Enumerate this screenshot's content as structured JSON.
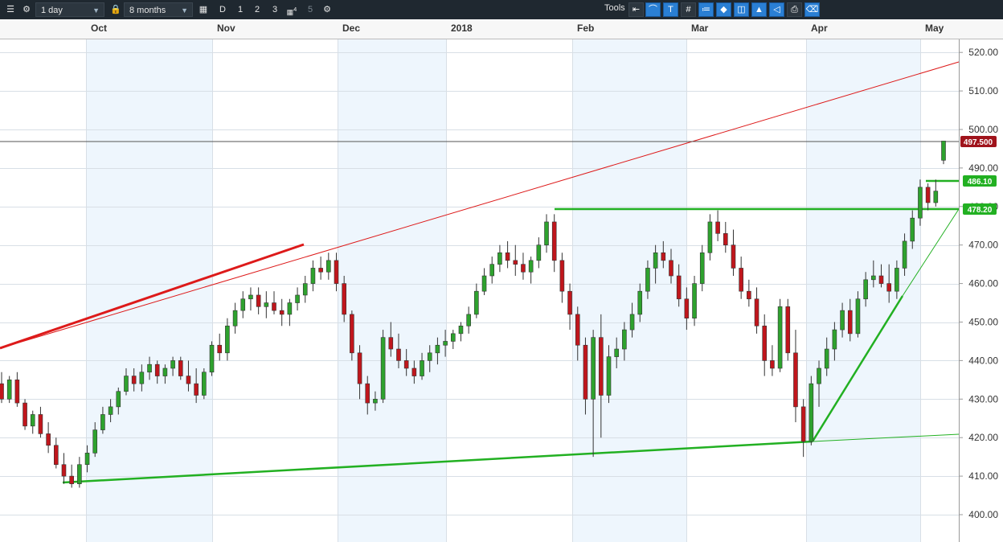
{
  "toolbar": {
    "interval": "1 day",
    "range": "8 months",
    "period_buttons": [
      "D",
      "1",
      "2",
      "3",
      "4",
      "5"
    ],
    "tools_label": "Tools"
  },
  "chart_data": {
    "type": "candlestick",
    "x_tick_labels": [
      "Oct",
      "Nov",
      "Dec",
      "2018",
      "Feb",
      "Mar",
      "Apr",
      "May"
    ],
    "y_tick_labels": [
      "400.00",
      "410.00",
      "420.00",
      "430.00",
      "440.00",
      "450.00",
      "460.00",
      "470.00",
      "480.00",
      "490.00",
      "500.00",
      "510.00",
      "520.00"
    ],
    "ylim": [
      394,
      530
    ],
    "current_price": "497.500",
    "price_tags": [
      {
        "value": "497.500",
        "color": "#a0141c"
      },
      {
        "value": "486.10",
        "color": "#22b022"
      },
      {
        "value": "478.20",
        "color": "#22b022"
      }
    ],
    "colors": {
      "up": "#2ea22e",
      "down": "#c0161c",
      "trend_green": "#22b022",
      "trend_red": "#dd1a1a",
      "shade": "#eef6fd"
    },
    "candles": [
      [
        434,
        437,
        429,
        430
      ],
      [
        430,
        436,
        429,
        435
      ],
      [
        435,
        437,
        428,
        429
      ],
      [
        429,
        430,
        422,
        423
      ],
      [
        423,
        427,
        421,
        426
      ],
      [
        426,
        428,
        420,
        421
      ],
      [
        421,
        424,
        416,
        418
      ],
      [
        418,
        420,
        412,
        413
      ],
      [
        413,
        416,
        408,
        410
      ],
      [
        410,
        413,
        407,
        408
      ],
      [
        408,
        415,
        407,
        413
      ],
      [
        413,
        418,
        411,
        416
      ],
      [
        416,
        424,
        415,
        422
      ],
      [
        422,
        428,
        421,
        426
      ],
      [
        426,
        430,
        424,
        428
      ],
      [
        428,
        433,
        426,
        432
      ],
      [
        432,
        438,
        431,
        436
      ],
      [
        436,
        438,
        432,
        434
      ],
      [
        434,
        439,
        432,
        437
      ],
      [
        437,
        441,
        435,
        439
      ],
      [
        439,
        440,
        434,
        436
      ],
      [
        436,
        439,
        434,
        438
      ],
      [
        438,
        441,
        436,
        440
      ],
      [
        440,
        441,
        435,
        436
      ],
      [
        436,
        440,
        432,
        434
      ],
      [
        434,
        438,
        429,
        431
      ],
      [
        431,
        438,
        430,
        437
      ],
      [
        437,
        445,
        436,
        444
      ],
      [
        444,
        447,
        440,
        442
      ],
      [
        442,
        451,
        440,
        449
      ],
      [
        449,
        455,
        447,
        453
      ],
      [
        453,
        458,
        451,
        456
      ],
      [
        456,
        459,
        453,
        457
      ],
      [
        457,
        459,
        452,
        454
      ],
      [
        454,
        458,
        451,
        455
      ],
      [
        455,
        458,
        452,
        453
      ],
      [
        453,
        456,
        449,
        452
      ],
      [
        452,
        456,
        449,
        455
      ],
      [
        455,
        459,
        453,
        457
      ],
      [
        457,
        462,
        455,
        460
      ],
      [
        460,
        466,
        458,
        464
      ],
      [
        464,
        467,
        461,
        463
      ],
      [
        463,
        468,
        461,
        466
      ],
      [
        466,
        468,
        458,
        460
      ],
      [
        460,
        462,
        450,
        452
      ],
      [
        452,
        453,
        440,
        442
      ],
      [
        442,
        444,
        430,
        434
      ],
      [
        434,
        436,
        426,
        429
      ],
      [
        429,
        432,
        427,
        430
      ],
      [
        430,
        448,
        429,
        446
      ],
      [
        446,
        450,
        441,
        443
      ],
      [
        443,
        447,
        438,
        440
      ],
      [
        440,
        443,
        436,
        438
      ],
      [
        438,
        440,
        434,
        436
      ],
      [
        436,
        442,
        435,
        440
      ],
      [
        440,
        444,
        437,
        442
      ],
      [
        442,
        446,
        439,
        444
      ],
      [
        444,
        448,
        441,
        445
      ],
      [
        445,
        448,
        443,
        447
      ],
      [
        447,
        450,
        445,
        449
      ],
      [
        449,
        454,
        447,
        452
      ],
      [
        452,
        460,
        451,
        458
      ],
      [
        458,
        464,
        457,
        462
      ],
      [
        462,
        467,
        460,
        465
      ],
      [
        465,
        470,
        463,
        468
      ],
      [
        468,
        471,
        464,
        466
      ],
      [
        466,
        470,
        462,
        465
      ],
      [
        465,
        468,
        461,
        463
      ],
      [
        463,
        467,
        460,
        466
      ],
      [
        466,
        472,
        464,
        470
      ],
      [
        470,
        478,
        468,
        476
      ],
      [
        476,
        478,
        463,
        466
      ],
      [
        466,
        468,
        455,
        458
      ],
      [
        458,
        460,
        448,
        452
      ],
      [
        452,
        454,
        440,
        444
      ],
      [
        444,
        446,
        426,
        430
      ],
      [
        430,
        448,
        415,
        446
      ],
      [
        446,
        452,
        420,
        431
      ],
      [
        431,
        444,
        429,
        441
      ],
      [
        441,
        446,
        438,
        443
      ],
      [
        443,
        450,
        440,
        448
      ],
      [
        448,
        455,
        446,
        452
      ],
      [
        452,
        460,
        450,
        458
      ],
      [
        458,
        466,
        456,
        464
      ],
      [
        464,
        470,
        460,
        468
      ],
      [
        468,
        471,
        464,
        466
      ],
      [
        466,
        469,
        460,
        462
      ],
      [
        462,
        465,
        454,
        456
      ],
      [
        456,
        459,
        448,
        451
      ],
      [
        451,
        462,
        449,
        460
      ],
      [
        460,
        470,
        458,
        468
      ],
      [
        468,
        478,
        466,
        476
      ],
      [
        476,
        479,
        471,
        473
      ],
      [
        473,
        476,
        468,
        470
      ],
      [
        470,
        474,
        462,
        464
      ],
      [
        464,
        467,
        456,
        458
      ],
      [
        458,
        461,
        454,
        456
      ],
      [
        456,
        459,
        447,
        449
      ],
      [
        449,
        452,
        436,
        440
      ],
      [
        440,
        444,
        436,
        438
      ],
      [
        438,
        456,
        437,
        454
      ],
      [
        454,
        456,
        440,
        442
      ],
      [
        442,
        448,
        424,
        428
      ],
      [
        428,
        430,
        415,
        419
      ],
      [
        419,
        436,
        418,
        434
      ],
      [
        434,
        440,
        428,
        438
      ],
      [
        438,
        446,
        436,
        443
      ],
      [
        443,
        450,
        440,
        448
      ],
      [
        448,
        455,
        446,
        453
      ],
      [
        453,
        456,
        445,
        447
      ],
      [
        447,
        458,
        446,
        456
      ],
      [
        456,
        463,
        454,
        461
      ],
      [
        461,
        466,
        459,
        462
      ],
      [
        462,
        465,
        459,
        460
      ],
      [
        460,
        465,
        455,
        458
      ],
      [
        458,
        466,
        456,
        464
      ],
      [
        464,
        473,
        462,
        471
      ],
      [
        471,
        479,
        469,
        477
      ],
      [
        477,
        487,
        475,
        485
      ],
      [
        485,
        486,
        479,
        481
      ],
      [
        481,
        487,
        480,
        484
      ],
      [
        492,
        497,
        491,
        497
      ]
    ]
  }
}
